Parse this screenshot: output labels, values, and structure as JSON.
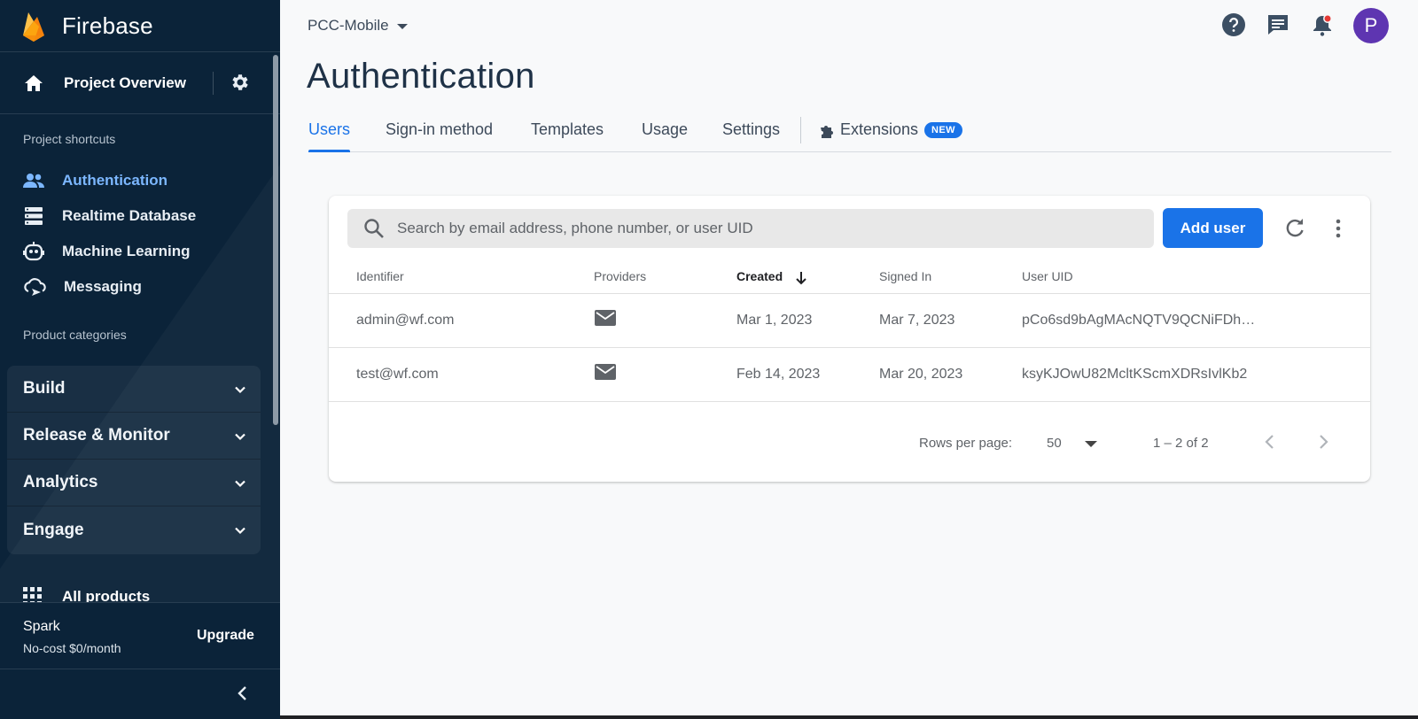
{
  "sidebar": {
    "brand": "Firebase",
    "project_overview": "Project Overview",
    "shortcuts_heading": "Project shortcuts",
    "shortcuts": [
      {
        "label": "Authentication",
        "icon": "people-icon",
        "active": true
      },
      {
        "label": "Realtime Database",
        "icon": "database-icon",
        "active": false
      },
      {
        "label": "Machine Learning",
        "icon": "robot-icon",
        "active": false
      },
      {
        "label": "Messaging",
        "icon": "messaging-cloud-icon",
        "active": false
      }
    ],
    "categories_heading": "Product categories",
    "categories": [
      "Build",
      "Release & Monitor",
      "Analytics",
      "Engage"
    ],
    "all_products": "All products",
    "plan": {
      "name": "Spark",
      "price": "No-cost $0/month",
      "upgrade": "Upgrade"
    }
  },
  "topbar": {
    "project": "PCC-Mobile",
    "avatar_letter": "P",
    "icons": [
      "help-icon",
      "feedback-icon",
      "notifications-icon"
    ]
  },
  "page": {
    "title": "Authentication",
    "tabs": [
      "Users",
      "Sign-in method",
      "Templates",
      "Usage",
      "Settings",
      "Extensions"
    ],
    "active_tab": "Users",
    "new_badge": "NEW"
  },
  "users": {
    "search_placeholder": "Search by email address, phone number, or user UID",
    "add_user": "Add user",
    "columns": [
      "Identifier",
      "Providers",
      "Created",
      "Signed In",
      "User UID"
    ],
    "sorted_column": "Created",
    "rows": [
      {
        "identifier": "admin@wf.com",
        "provider": "email-icon",
        "created": "Mar 1, 2023",
        "signed_in": "Mar 7, 2023",
        "uid": "pCo6sd9bAgMAcNQTV9QCNiFDh…"
      },
      {
        "identifier": "test@wf.com",
        "provider": "email-icon",
        "created": "Feb 14, 2023",
        "signed_in": "Mar 20, 2023",
        "uid": "ksyKJOwU82McltKScmXDRsIvlKb2"
      }
    ],
    "rows_per_page_label": "Rows per page:",
    "rows_per_page": "50",
    "range": "1 – 2 of 2"
  },
  "colors": {
    "sidebar_bg": "#0b2339",
    "accent": "#1a73e8",
    "active_nav": "#7cb7ff",
    "avatar": "#5e35b1"
  }
}
